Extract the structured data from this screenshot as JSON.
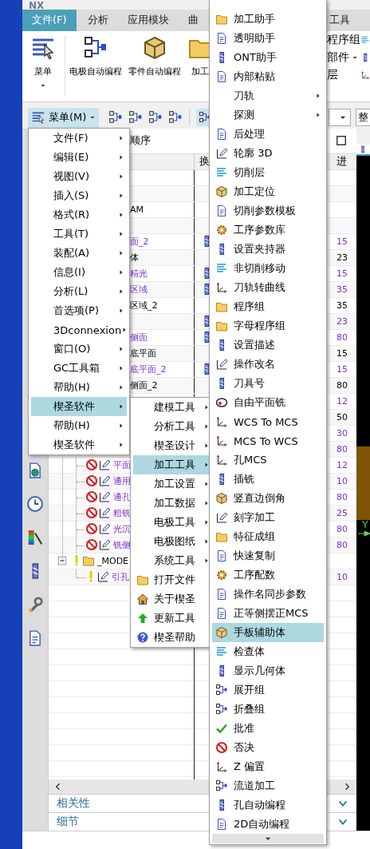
{
  "title_bar": {
    "logo": "NX"
  },
  "ribbon": {
    "tabs": [
      {
        "label": "文件(F)",
        "selected": true
      },
      {
        "label": "分析",
        "selected": false
      },
      {
        "label": "应用模块",
        "selected": false
      },
      {
        "label": "曲",
        "selected": false
      },
      {
        "label": "工具",
        "selected": false
      }
    ],
    "menu_button": "菜单",
    "commands": [
      "电极自动编程",
      "零件自动编程",
      "加工"
    ],
    "side_commands": [
      {
        "label": "程序组",
        "kind": "button"
      },
      {
        "label": "部件",
        "kind": "dropdown"
      },
      {
        "label": "层",
        "kind": "button"
      }
    ]
  },
  "toolbar": {
    "menu_button": "菜单(M)",
    "view_field": "整"
  },
  "navigator": {
    "title": "顺序",
    "columns": [
      "换",
      "进"
    ],
    "rows": [
      {
        "kind": "plain"
      },
      {
        "kind": "plain"
      },
      {
        "kind": "plain",
        "name": "AM",
        "color": "#000000"
      },
      {
        "kind": "plain"
      },
      {
        "kind": "plain",
        "name": "面_2",
        "feed": "15",
        "color": "#7a2fd6",
        "tool": true
      },
      {
        "kind": "plain",
        "name": "体",
        "feed": "23",
        "color": "#000000",
        "tool": false
      },
      {
        "kind": "plain",
        "name": "精光",
        "feed": "15",
        "color": "#7a2fd6",
        "tool": true
      },
      {
        "kind": "plain",
        "name": "区域",
        "feed": "35",
        "color": "#7a2fd6",
        "tool": true
      },
      {
        "kind": "plain",
        "name": "区域_2",
        "feed": "35",
        "color": "#000000",
        "tool": false
      },
      {
        "kind": "plain",
        "feed": "23",
        "color": "#7a2fd6",
        "tool": true
      },
      {
        "kind": "plain",
        "name": "侧面",
        "feed": "80",
        "color": "#7a2fd6",
        "tool": true
      },
      {
        "kind": "plain",
        "name": "底平面",
        "feed": "15",
        "color": "#000000",
        "tool": false
      },
      {
        "kind": "plain",
        "name": "底平面_2",
        "feed": "15",
        "color": "#7a2fd6",
        "tool": true
      },
      {
        "kind": "plain",
        "name": "侧面_2",
        "feed": "80",
        "color": "#000000",
        "tool": false
      },
      {
        "kind": "plain",
        "feed": "12",
        "color": "#7a2fd6"
      },
      {
        "kind": "plain",
        "feed": "50",
        "color": "#000000"
      },
      {
        "kind": "plain",
        "feed": "30",
        "color": "#7a2fd6"
      },
      {
        "kind": "plain",
        "feed": "80",
        "color": "#7a2fd6"
      },
      {
        "kind": "operation",
        "name": "平面",
        "feed": "12",
        "color": "#7a2fd6"
      },
      {
        "kind": "operation",
        "name": "通用",
        "feed": "10",
        "color": "#7a2fd6"
      },
      {
        "kind": "operation",
        "name": "通孔",
        "feed": "80",
        "color": "#7a2fd6"
      },
      {
        "kind": "operation",
        "name": "粗铣",
        "feed": "25",
        "color": "#7a2fd6"
      },
      {
        "kind": "operation",
        "name": "光沉",
        "feed": "80",
        "color": "#7a2fd6"
      },
      {
        "kind": "operation",
        "name": "铣侧",
        "feed": "80",
        "color": "#7a2fd6"
      },
      {
        "kind": "group",
        "name": "_MODE",
        "color": "#000000"
      },
      {
        "kind": "child",
        "name": "引孔",
        "feed": "10",
        "color": "#7a2fd6"
      }
    ],
    "panels": [
      "相关性",
      "细节"
    ]
  },
  "graphics": {
    "axis_label": "Y"
  },
  "menus": [
    {
      "items": [
        {
          "label": "文件(F)",
          "kind": "submenu",
          "selected": false
        },
        {
          "label": "编辑(E)",
          "kind": "submenu",
          "selected": false
        },
        {
          "label": "视图(V)",
          "kind": "submenu",
          "selected": false
        },
        {
          "label": "插入(S)",
          "kind": "submenu",
          "selected": false
        },
        {
          "label": "格式(R)",
          "kind": "submenu",
          "selected": false
        },
        {
          "label": "工具(T)",
          "kind": "submenu",
          "selected": false
        },
        {
          "label": "装配(A)",
          "kind": "submenu",
          "selected": false
        },
        {
          "label": "信息(I)",
          "kind": "submenu",
          "selected": false
        },
        {
          "label": "分析(L)",
          "kind": "submenu",
          "selected": false
        },
        {
          "label": "首选项(P)",
          "kind": "submenu",
          "selected": false
        },
        {
          "label": "3Dconnexion",
          "kind": "submenu",
          "selected": false
        },
        {
          "label": "窗口(O)",
          "kind": "submenu",
          "selected": false
        },
        {
          "label": "GC工具箱",
          "kind": "submenu",
          "selected": false
        },
        {
          "label": "帮助(H)",
          "kind": "submenu",
          "selected": false
        },
        {
          "label": "楔圣软件",
          "kind": "submenu",
          "selected": true
        },
        {
          "label": "帮助(H)",
          "kind": "submenu",
          "selected": false
        },
        {
          "label": "楔圣软件",
          "kind": "submenu",
          "selected": false
        }
      ]
    },
    {
      "items": [
        {
          "label": "建模工具",
          "kind": "submenu",
          "selected": false
        },
        {
          "label": "分析工具",
          "kind": "submenu",
          "selected": false
        },
        {
          "label": "楔圣设计",
          "kind": "submenu",
          "selected": false
        },
        {
          "label": "加工工具",
          "kind": "submenu",
          "selected": true
        },
        {
          "label": "加工设置",
          "kind": "submenu",
          "selected": false
        },
        {
          "label": "加工数据",
          "kind": "submenu",
          "selected": false
        },
        {
          "label": "电极工具",
          "kind": "submenu",
          "selected": false
        },
        {
          "label": "电极图纸",
          "kind": "submenu",
          "selected": false
        },
        {
          "label": "系统工具",
          "kind": "submenu",
          "selected": false
        },
        {
          "label": "打开文件",
          "kind": "command",
          "selected": false
        },
        {
          "label": "关于楔圣",
          "kind": "command",
          "selected": false
        },
        {
          "label": "更新工具",
          "kind": "command",
          "selected": false
        },
        {
          "label": "楔圣帮助",
          "kind": "command",
          "selected": false
        }
      ]
    },
    {
      "items": [
        {
          "label": "加工助手",
          "kind": "command",
          "selected": false
        },
        {
          "label": "透明助手",
          "kind": "command",
          "selected": false
        },
        {
          "label": "ONT助手",
          "kind": "command",
          "selected": false
        },
        {
          "label": "内部粘贴",
          "kind": "command",
          "selected": false
        },
        {
          "label": "刀轨",
          "kind": "submenu",
          "selected": false
        },
        {
          "label": "探测",
          "kind": "submenu",
          "selected": false
        },
        {
          "label": "后处理",
          "kind": "command",
          "selected": false
        },
        {
          "label": "轮廓 3D",
          "kind": "command",
          "selected": false
        },
        {
          "label": "切削层",
          "kind": "command",
          "selected": false
        },
        {
          "label": "加工定位",
          "kind": "command",
          "selected": false
        },
        {
          "label": "切削参数模板",
          "kind": "command",
          "selected": false
        },
        {
          "label": "工序参数库",
          "kind": "command",
          "selected": false
        },
        {
          "label": "设置夹持器",
          "kind": "command",
          "selected": false
        },
        {
          "label": "非切削移动",
          "kind": "command",
          "selected": false
        },
        {
          "label": "刀轨转曲线",
          "kind": "command",
          "selected": false
        },
        {
          "label": "程序组",
          "kind": "command",
          "selected": false
        },
        {
          "label": "字母程序组",
          "kind": "command",
          "selected": false
        },
        {
          "label": "设置描述",
          "kind": "command",
          "selected": false
        },
        {
          "label": "操作改名",
          "kind": "command",
          "selected": false
        },
        {
          "label": "刀具号",
          "kind": "command",
          "selected": false
        },
        {
          "label": "自由平面铣",
          "kind": "command",
          "selected": false
        },
        {
          "label": "WCS To MCS",
          "kind": "command",
          "selected": false
        },
        {
          "label": "MCS To WCS",
          "kind": "command",
          "selected": false
        },
        {
          "label": "孔MCS",
          "kind": "command",
          "selected": false
        },
        {
          "label": "插铣",
          "kind": "command",
          "selected": false
        },
        {
          "label": "竖直边倒角",
          "kind": "command",
          "selected": false
        },
        {
          "label": "刻字加工",
          "kind": "command",
          "selected": false
        },
        {
          "label": "特征成组",
          "kind": "command",
          "selected": false
        },
        {
          "label": "快速复制",
          "kind": "command",
          "selected": false
        },
        {
          "label": "工序配数",
          "kind": "command",
          "selected": false
        },
        {
          "label": "操作名同步参数",
          "kind": "command",
          "selected": false
        },
        {
          "label": "正等侧摆正MCS",
          "kind": "command",
          "selected": false
        },
        {
          "label": "手板辅助体",
          "kind": "command",
          "selected": true
        },
        {
          "label": "检查体",
          "kind": "command",
          "selected": false
        },
        {
          "label": "显示几何体",
          "kind": "command",
          "selected": false
        },
        {
          "label": "展开组",
          "kind": "command",
          "selected": false
        },
        {
          "label": "折叠组",
          "kind": "command",
          "selected": false
        },
        {
          "label": "批准",
          "kind": "command",
          "selected": false
        },
        {
          "label": "否决",
          "kind": "command",
          "selected": false
        },
        {
          "label": "Z 偏置",
          "kind": "command",
          "selected": false
        },
        {
          "label": "流道加工",
          "kind": "command",
          "selected": false
        },
        {
          "label": "孔自动编程",
          "kind": "command",
          "selected": false
        },
        {
          "label": "2D自动编程",
          "kind": "command",
          "selected": false
        }
      ]
    }
  ]
}
